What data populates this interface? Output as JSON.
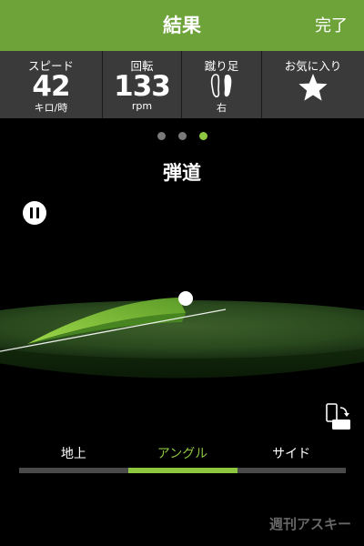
{
  "navbar": {
    "title": "結果",
    "done_label": "完了"
  },
  "stats": {
    "speed": {
      "label": "スピード",
      "value": "42",
      "unit": "キロ/時"
    },
    "spin": {
      "label": "回転",
      "value": "133",
      "unit": "rpm"
    },
    "kicking_foot": {
      "label": "蹴り足",
      "value": "右",
      "icon": "footprints-icon"
    },
    "favorite": {
      "label": "お気に入り",
      "icon": "star-icon"
    }
  },
  "pager": {
    "count": 3,
    "active_index": 2
  },
  "section": {
    "title": "弾道"
  },
  "view_tabs": {
    "items": [
      {
        "label": "地上"
      },
      {
        "label": "アングル"
      },
      {
        "label": "サイド"
      }
    ],
    "active_index": 1
  },
  "watermark": {
    "text": "週刊アスキー"
  },
  "colors": {
    "accent": "#8dc63f",
    "navbar": "#6ea33a",
    "stats_bg": "#3a3a3a"
  }
}
